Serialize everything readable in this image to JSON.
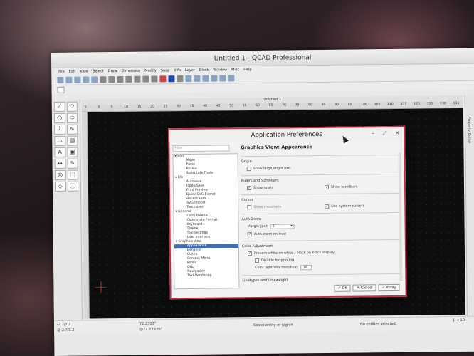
{
  "window": {
    "title": "Untitled 1 - QCAD Professional"
  },
  "menu": [
    "File",
    "Edit",
    "View",
    "Select",
    "Draw",
    "Dimension",
    "Modify",
    "Snap",
    "Info",
    "Layer",
    "Block",
    "Window",
    "Misc",
    "Help"
  ],
  "drawing_tab": "Untitled 1",
  "ruler_ticks": [
    "5",
    "0",
    "5",
    "10",
    "15",
    "20",
    "25",
    "30",
    "35",
    "40",
    "45",
    "50",
    "55",
    "60",
    "65",
    "70",
    "75",
    "80",
    "85",
    "90",
    "95",
    "100",
    "105",
    "110",
    "115",
    "120",
    "125",
    "130",
    "135"
  ],
  "right_panel_label": "Property Editor",
  "status": {
    "coord_abs": "-2.7/2.2",
    "coord_rel": "@-2.7/2.2",
    "coord_polar": "72.2303°",
    "coord_polar2": "@72.23<85°",
    "prompt": "Select entity or region",
    "selection": "No entities selected.",
    "grid": "1 < 10"
  },
  "dialog": {
    "title": "Application Preferences",
    "filter_placeholder": "Filter",
    "page_title": "Graphics View: Appearance",
    "tree": [
      {
        "label": "Edit",
        "type": "grp"
      },
      {
        "label": "Move",
        "type": "it"
      },
      {
        "label": "Paste",
        "type": "it"
      },
      {
        "label": "Rotate",
        "type": "it"
      },
      {
        "label": "Substitute Fonts",
        "type": "it"
      },
      {
        "label": "File",
        "type": "grp"
      },
      {
        "label": "Autosave",
        "type": "it"
      },
      {
        "label": "Open/Save",
        "type": "it"
      },
      {
        "label": "Print Preview",
        "type": "it"
      },
      {
        "label": "Quick SVG Export",
        "type": "it"
      },
      {
        "label": "Recent Files",
        "type": "it"
      },
      {
        "label": "SVG Import",
        "type": "it"
      },
      {
        "label": "Templates",
        "type": "it"
      },
      {
        "label": "General",
        "type": "grp"
      },
      {
        "label": "Color Palette",
        "type": "it"
      },
      {
        "label": "Coordinate Format",
        "type": "it"
      },
      {
        "label": "Keyboard",
        "type": "it"
      },
      {
        "label": "Theme",
        "type": "it"
      },
      {
        "label": "Tool Settings",
        "type": "it"
      },
      {
        "label": "User Interface",
        "type": "it"
      },
      {
        "label": "Graphics View",
        "type": "grp"
      },
      {
        "label": "Appearance",
        "type": "sel"
      },
      {
        "label": "Behavior",
        "type": "it"
      },
      {
        "label": "Colors",
        "type": "it"
      },
      {
        "label": "Context Menu",
        "type": "it"
      },
      {
        "label": "Fonts",
        "type": "it"
      },
      {
        "label": "Grid",
        "type": "it"
      },
      {
        "label": "Navigation",
        "type": "it"
      },
      {
        "label": "Text Rendering",
        "type": "it"
      }
    ],
    "sections": {
      "origin": "Origin",
      "show_large_origin": "Show large origin axis",
      "rulers": "Rulers and Scrollbars",
      "show_rulers": "Show rulers",
      "show_scrollbars": "Show scrollbars",
      "cursor": "Cursor",
      "show_crosshairs": "Show crosshairs",
      "use_system_cursors": "Use system cursors",
      "auto_zoom": "Auto Zoom",
      "margin_label": "Margin (px):",
      "margin_value": "1",
      "auto_zoom_on_load": "Auto zoom on load",
      "color_adjust": "Color Adjustment",
      "prevent_white": "Prevent white on white / black on black display",
      "disable_printing": "Disable for printing",
      "lightness_label": "Color lightness threshold:",
      "lightness_value": "10",
      "linetypes": "Linetypes and Lineweight"
    },
    "buttons": {
      "ok": "OK",
      "cancel": "Cancel",
      "apply": "Apply"
    }
  }
}
